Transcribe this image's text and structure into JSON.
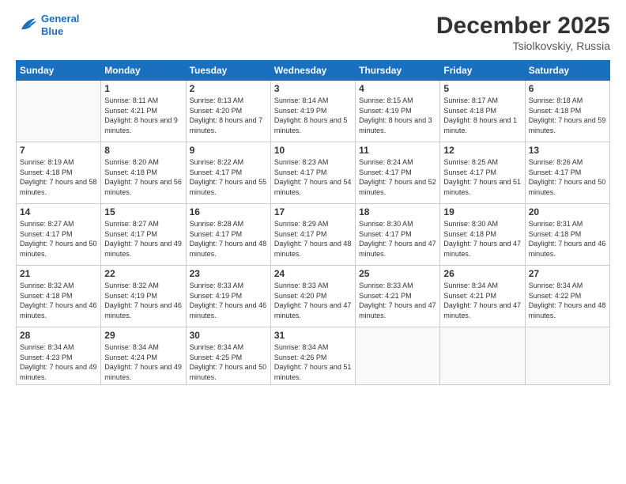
{
  "logo": {
    "line1": "General",
    "line2": "Blue"
  },
  "header": {
    "month": "December 2025",
    "location": "Tsiolkovskiy, Russia"
  },
  "weekdays": [
    "Sunday",
    "Monday",
    "Tuesday",
    "Wednesday",
    "Thursday",
    "Friday",
    "Saturday"
  ],
  "weeks": [
    [
      {
        "day": "",
        "sunrise": "",
        "sunset": "",
        "daylight": ""
      },
      {
        "day": "1",
        "sunrise": "Sunrise: 8:11 AM",
        "sunset": "Sunset: 4:21 PM",
        "daylight": "Daylight: 8 hours and 9 minutes."
      },
      {
        "day": "2",
        "sunrise": "Sunrise: 8:13 AM",
        "sunset": "Sunset: 4:20 PM",
        "daylight": "Daylight: 8 hours and 7 minutes."
      },
      {
        "day": "3",
        "sunrise": "Sunrise: 8:14 AM",
        "sunset": "Sunset: 4:19 PM",
        "daylight": "Daylight: 8 hours and 5 minutes."
      },
      {
        "day": "4",
        "sunrise": "Sunrise: 8:15 AM",
        "sunset": "Sunset: 4:19 PM",
        "daylight": "Daylight: 8 hours and 3 minutes."
      },
      {
        "day": "5",
        "sunrise": "Sunrise: 8:17 AM",
        "sunset": "Sunset: 4:18 PM",
        "daylight": "Daylight: 8 hours and 1 minute."
      },
      {
        "day": "6",
        "sunrise": "Sunrise: 8:18 AM",
        "sunset": "Sunset: 4:18 PM",
        "daylight": "Daylight: 7 hours and 59 minutes."
      }
    ],
    [
      {
        "day": "7",
        "sunrise": "Sunrise: 8:19 AM",
        "sunset": "Sunset: 4:18 PM",
        "daylight": "Daylight: 7 hours and 58 minutes."
      },
      {
        "day": "8",
        "sunrise": "Sunrise: 8:20 AM",
        "sunset": "Sunset: 4:18 PM",
        "daylight": "Daylight: 7 hours and 56 minutes."
      },
      {
        "day": "9",
        "sunrise": "Sunrise: 8:22 AM",
        "sunset": "Sunset: 4:17 PM",
        "daylight": "Daylight: 7 hours and 55 minutes."
      },
      {
        "day": "10",
        "sunrise": "Sunrise: 8:23 AM",
        "sunset": "Sunset: 4:17 PM",
        "daylight": "Daylight: 7 hours and 54 minutes."
      },
      {
        "day": "11",
        "sunrise": "Sunrise: 8:24 AM",
        "sunset": "Sunset: 4:17 PM",
        "daylight": "Daylight: 7 hours and 52 minutes."
      },
      {
        "day": "12",
        "sunrise": "Sunrise: 8:25 AM",
        "sunset": "Sunset: 4:17 PM",
        "daylight": "Daylight: 7 hours and 51 minutes."
      },
      {
        "day": "13",
        "sunrise": "Sunrise: 8:26 AM",
        "sunset": "Sunset: 4:17 PM",
        "daylight": "Daylight: 7 hours and 50 minutes."
      }
    ],
    [
      {
        "day": "14",
        "sunrise": "Sunrise: 8:27 AM",
        "sunset": "Sunset: 4:17 PM",
        "daylight": "Daylight: 7 hours and 50 minutes."
      },
      {
        "day": "15",
        "sunrise": "Sunrise: 8:27 AM",
        "sunset": "Sunset: 4:17 PM",
        "daylight": "Daylight: 7 hours and 49 minutes."
      },
      {
        "day": "16",
        "sunrise": "Sunrise: 8:28 AM",
        "sunset": "Sunset: 4:17 PM",
        "daylight": "Daylight: 7 hours and 48 minutes."
      },
      {
        "day": "17",
        "sunrise": "Sunrise: 8:29 AM",
        "sunset": "Sunset: 4:17 PM",
        "daylight": "Daylight: 7 hours and 48 minutes."
      },
      {
        "day": "18",
        "sunrise": "Sunrise: 8:30 AM",
        "sunset": "Sunset: 4:17 PM",
        "daylight": "Daylight: 7 hours and 47 minutes."
      },
      {
        "day": "19",
        "sunrise": "Sunrise: 8:30 AM",
        "sunset": "Sunset: 4:18 PM",
        "daylight": "Daylight: 7 hours and 47 minutes."
      },
      {
        "day": "20",
        "sunrise": "Sunrise: 8:31 AM",
        "sunset": "Sunset: 4:18 PM",
        "daylight": "Daylight: 7 hours and 46 minutes."
      }
    ],
    [
      {
        "day": "21",
        "sunrise": "Sunrise: 8:32 AM",
        "sunset": "Sunset: 4:18 PM",
        "daylight": "Daylight: 7 hours and 46 minutes."
      },
      {
        "day": "22",
        "sunrise": "Sunrise: 8:32 AM",
        "sunset": "Sunset: 4:19 PM",
        "daylight": "Daylight: 7 hours and 46 minutes."
      },
      {
        "day": "23",
        "sunrise": "Sunrise: 8:33 AM",
        "sunset": "Sunset: 4:19 PM",
        "daylight": "Daylight: 7 hours and 46 minutes."
      },
      {
        "day": "24",
        "sunrise": "Sunrise: 8:33 AM",
        "sunset": "Sunset: 4:20 PM",
        "daylight": "Daylight: 7 hours and 47 minutes."
      },
      {
        "day": "25",
        "sunrise": "Sunrise: 8:33 AM",
        "sunset": "Sunset: 4:21 PM",
        "daylight": "Daylight: 7 hours and 47 minutes."
      },
      {
        "day": "26",
        "sunrise": "Sunrise: 8:34 AM",
        "sunset": "Sunset: 4:21 PM",
        "daylight": "Daylight: 7 hours and 47 minutes."
      },
      {
        "day": "27",
        "sunrise": "Sunrise: 8:34 AM",
        "sunset": "Sunset: 4:22 PM",
        "daylight": "Daylight: 7 hours and 48 minutes."
      }
    ],
    [
      {
        "day": "28",
        "sunrise": "Sunrise: 8:34 AM",
        "sunset": "Sunset: 4:23 PM",
        "daylight": "Daylight: 7 hours and 49 minutes."
      },
      {
        "day": "29",
        "sunrise": "Sunrise: 8:34 AM",
        "sunset": "Sunset: 4:24 PM",
        "daylight": "Daylight: 7 hours and 49 minutes."
      },
      {
        "day": "30",
        "sunrise": "Sunrise: 8:34 AM",
        "sunset": "Sunset: 4:25 PM",
        "daylight": "Daylight: 7 hours and 50 minutes."
      },
      {
        "day": "31",
        "sunrise": "Sunrise: 8:34 AM",
        "sunset": "Sunset: 4:26 PM",
        "daylight": "Daylight: 7 hours and 51 minutes."
      },
      {
        "day": "",
        "sunrise": "",
        "sunset": "",
        "daylight": ""
      },
      {
        "day": "",
        "sunrise": "",
        "sunset": "",
        "daylight": ""
      },
      {
        "day": "",
        "sunrise": "",
        "sunset": "",
        "daylight": ""
      }
    ]
  ]
}
